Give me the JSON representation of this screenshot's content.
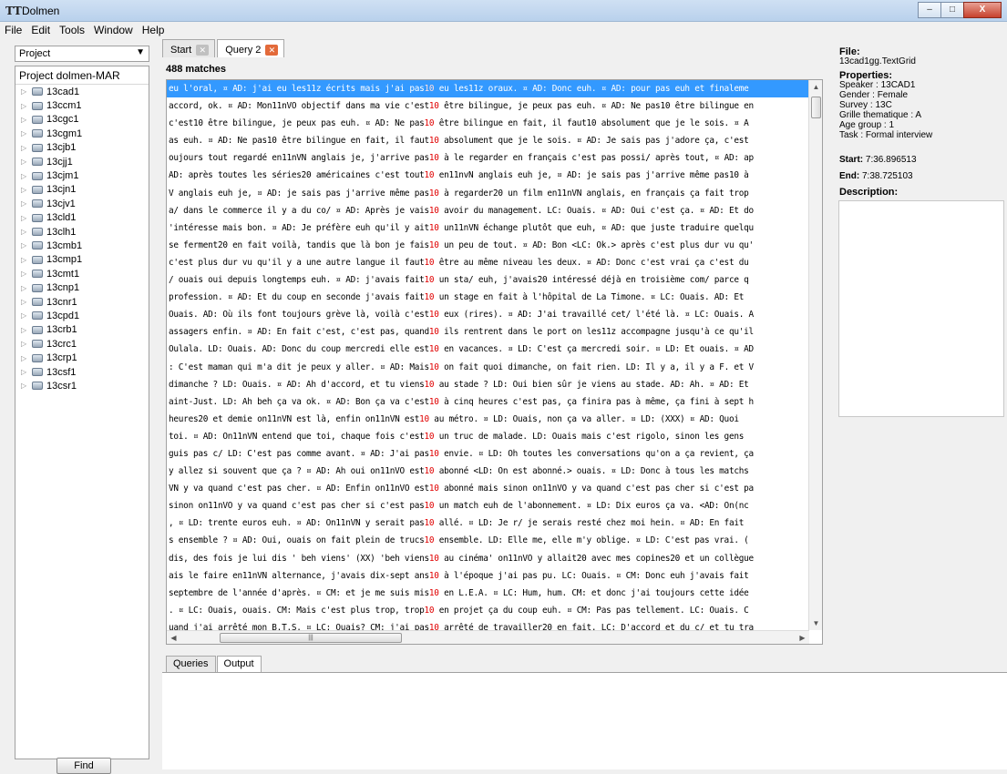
{
  "window": {
    "title": "Dolmen",
    "app_icon": "ΤΤ",
    "buttons": {
      "minimize": "–",
      "maximize": "□",
      "close": "X"
    }
  },
  "menu": [
    "File",
    "Edit",
    "Tools",
    "Window",
    "Help"
  ],
  "sidebar": {
    "selector": "Project",
    "root": "Project dolmen-MAR",
    "items": [
      "13cad1",
      "13ccm1",
      "13cgc1",
      "13cgm1",
      "13cjb1",
      "13cjj1",
      "13cjm1",
      "13cjn1",
      "13cjv1",
      "13cld1",
      "13clh1",
      "13cmb1",
      "13cmp1",
      "13cmt1",
      "13cnp1",
      "13cnr1",
      "13cpd1",
      "13crb1",
      "13crc1",
      "13crp1",
      "13csf1",
      "13csr1"
    ],
    "find_button": "Find"
  },
  "tabs": [
    {
      "label": "Start",
      "active": false
    },
    {
      "label": "Query 2",
      "active": true
    }
  ],
  "results": {
    "count_label": "488 matches",
    "selected_row": 0,
    "rows": [
      {
        "left": "eu l'oral, ¤ AD: j'ai eu les11z écrits mais j'ai pas",
        "kw": "10",
        "right": " eu les11z oraux. ¤ AD: Donc euh. ¤ AD: pour pas euh et finaleme"
      },
      {
        "left": "accord, ok. ¤ AD: Mon11nVO objectif dans ma vie c'est",
        "kw": "10",
        "right": " être bilingue, je peux pas euh. ¤ AD: Ne pas10 être bilingue en"
      },
      {
        "left": " c'est10 être bilingue, je peux pas euh. ¤ AD: Ne pas",
        "kw": "10",
        "right": " être bilingue en fait, il faut10 absolument que je le sois. ¤ A"
      },
      {
        "left": "as euh. ¤ AD: Ne pas10 être bilingue en fait, il faut",
        "kw": "10",
        "right": " absolument que je le sois. ¤ AD: Je sais pas j'adore ça, c'est"
      },
      {
        "left": "oujours tout regardé en11nVN anglais je, j'arrive pas",
        "kw": "10",
        "right": " à le regarder en français c'est pas possi/ après tout, ¤ AD: ap"
      },
      {
        "left": " AD: après toutes les séries20 américaines c'est tout",
        "kw": "10",
        "right": " en11nvN anglais euh je, ¤ AD: je sais pas j'arrive même pas10 à"
      },
      {
        "left": "V anglais euh je, ¤ AD: je sais pas j'arrive même pas",
        "kw": "10",
        "right": " à regarder20 un film en11nVN anglais, en français ça fait trop"
      },
      {
        "left": "a/ dans le commerce il y a du co/ ¤ AD: Après je vais",
        "kw": "10",
        "right": " avoir du management. LC: Ouais. ¤ AD: Oui c'est ça. ¤ AD: Et do"
      },
      {
        "left": "'intéresse mais bon. ¤ AD: Je préfère euh qu'il y ait",
        "kw": "10",
        "right": " un11nVN échange plutôt que euh, ¤ AD: que juste traduire quelqu"
      },
      {
        "left": "se ferment20 en fait voilà, tandis que là bon je fais",
        "kw": "10",
        "right": " un peu de tout. ¤ AD: Bon <LC: Ok.> après c'est plus dur vu qu'"
      },
      {
        "left": " c'est plus dur vu qu'il y a une autre langue il faut",
        "kw": "10",
        "right": " être au même niveau les deux. ¤ AD: Donc c'est vrai ça c'est du"
      },
      {
        "left": "/ ouais oui depuis longtemps euh. ¤ AD: j'avais fait",
        "kw": "10",
        "right": " un sta/ euh, j'avais20 intéressé déjà en troisième com/ parce q"
      },
      {
        "left": " profession. ¤ AD: Et du coup en seconde j'avais fait",
        "kw": "10",
        "right": " un stage en fait à l'hôpital de La Timone. ¤ LC: Ouais. AD: Et"
      },
      {
        "left": "Ouais. AD: Où ils font toujours grève là, voilà c'est",
        "kw": "10",
        "right": " eux (rires). ¤ AD: J'ai travaillé cet/ l'été là. ¤ LC: Ouais. A"
      },
      {
        "left": "assagers enfin. ¤ AD: En fait c'est, c'est pas, quand",
        "kw": "10",
        "right": " ils rentrent dans le port on les11z accompagne jusqu'à ce qu'il"
      },
      {
        "left": "Oulala. LD: Ouais. AD: Donc du coup mercredi elle est",
        "kw": "10",
        "right": " en vacances. ¤ LD: C'est ça mercredi soir. ¤ LD: Et ouais. ¤ AD"
      },
      {
        "left": ": C'est maman qui m'a dit je peux y aller. ¤ AD: Mais",
        "kw": "10",
        "right": " on fait quoi dimanche, on fait rien. LD: Il y a, il y a F. et V"
      },
      {
        "left": " dimanche ? LD: Ouais. ¤ AD: Ah d'accord, et tu viens",
        "kw": "10",
        "right": " au stade ? LD: Oui bien sûr je viens au stade. AD: Ah. ¤ AD: Et"
      },
      {
        "left": "aint-Just. LD: Ah beh ça va ok. ¤ AD: Bon ça va c'est",
        "kw": "10",
        "right": " à cinq heures c'est pas, ça finira pas à même, ça fini à sept h"
      },
      {
        "left": " heures20 et demie on11nVN est là, enfin on11nVN est",
        "kw": "10",
        "right": " au métro. ¤ LD: Ouais, non ça va aller. ¤ LD: (XXX) ¤ AD: Quoi"
      },
      {
        "left": " toi. ¤ AD: On11nVN entend que toi, chaque fois c'est",
        "kw": "10",
        "right": " un truc de malade. LD: Ouais mais c'est rigolo, sinon les gens"
      },
      {
        "left": "guis pas c/ LD: C'est pas comme avant. ¤ AD: J'ai pas",
        "kw": "10",
        "right": " envie. ¤ LD: Oh toutes les conversations qu'on a ça revient, ça"
      },
      {
        "left": " y allez si souvent que ça ? ¤ AD: Ah oui on11nVO est",
        "kw": "10",
        "right": " abonné <LD: On est abonné.> ouais. ¤ LD: Donc à tous les matchs"
      },
      {
        "left": "VN y va quand c'est pas cher. ¤ AD: Enfin on11nVO est",
        "kw": "10",
        "right": " abonné mais sinon on11nVO y va quand c'est pas cher si c'est pa"
      },
      {
        "left": " sinon on11nVO y va quand c'est pas cher si c'est pas",
        "kw": "10",
        "right": " un match euh de l'abonnement. ¤ LD: Dix euros ça va. <AD: On(nc"
      },
      {
        "left": ", ¤ LD: trente euros euh. ¤ AD: On11nVN y serait pas",
        "kw": "10",
        "right": " allé. ¤ LD: Je r/ je serais resté chez moi hein. ¤ AD: En fait"
      },
      {
        "left": "s ensemble ? ¤ AD: Oui, ouais on fait plein de trucs",
        "kw": "10",
        "right": " ensemble. LD: Elle me, elle m'y oblige. ¤ LD: C'est pas vrai. ("
      },
      {
        "left": "dis, des fois je lui dis ' beh viens' (XX) 'beh viens",
        "kw": "10",
        "right": " au cinéma' on11nVO y allait20 avec mes copines20 et un collègue"
      },
      {
        "left": "ais le faire en11nVN alternance, j'avais dix-sept ans",
        "kw": "10",
        "right": " à l'époque j'ai pas pu. LC: Ouais. ¤ CM: Donc euh j'avais fait"
      },
      {
        "left": "septembre de l'année d'après. ¤ CM: et je me suis mis",
        "kw": "10",
        "right": " en L.E.A. ¤ LC: Hum, hum. CM: et donc j'ai toujours cette idée"
      },
      {
        "left": ". ¤ LC: Ouais, ouais. CM: Mais c'est plus trop, trop",
        "kw": "10",
        "right": " en projet ça du coup euh. ¤ CM: Pas pas tellement. LC: Ouais. C"
      },
      {
        "left": "uand j'ai arrêté mon B.T.S. ¤ LC: Ouais? CM: j'ai pas",
        "kw": "10",
        "right": " arrêté de travailler20 en fait. LC: D'accord et du c/ et tu tra"
      }
    ]
  },
  "bottom_tabs": [
    "Queries",
    "Output"
  ],
  "properties": {
    "file_heading": "File:",
    "file": "13cad1gg.TextGrid",
    "properties_heading": "Properties:",
    "lines": [
      "Speaker : 13CAD1",
      "Gender : Female",
      "Survey : 13C",
      "Grille thematique : A",
      "Age group : 1",
      "Task : Formal interview"
    ],
    "start_label": "Start:",
    "start": "7:36.896513",
    "end_label": "End:",
    "end": "7:38.725103",
    "description_heading": "Description:"
  }
}
